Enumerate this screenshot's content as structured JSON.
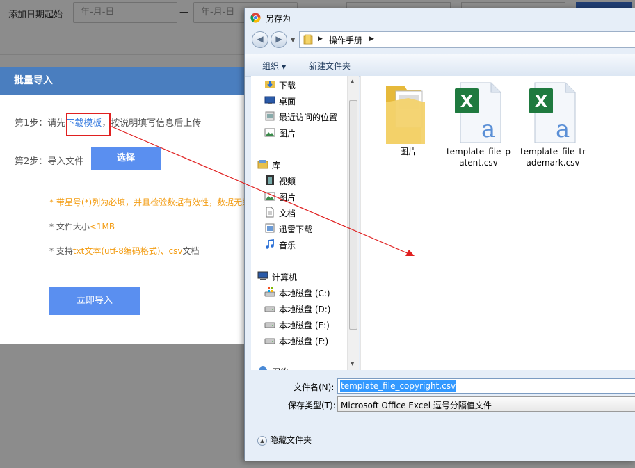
{
  "background_page": {
    "filter_label": "添加日期起始",
    "date_start_placeholder": "年-月-日",
    "date_separator": "—",
    "date_end_placeholder": "年-月-日"
  },
  "modal": {
    "title": "批量导入",
    "step1_prefix": "第1步：请先",
    "step1_link": "下载模板",
    "step1_suffix": "，按说明填写信息后上传",
    "step2_label": "第2步：导入文件",
    "select_button": "选择",
    "note1": "* 带星号(*)列为必填，并且检验数据有效性，数据无效",
    "note2_prefix": "* 文件大小",
    "note2_value": "<1MB",
    "note3_prefix": "* 支持",
    "note3_formats": "txt文本(utf-8编码格式)、csv",
    "note3_suffix": "文档",
    "import_button": "立即导入",
    "accent_color": "#4a7ebf",
    "button_color": "#5a8ff0",
    "note_color": "#f39c12"
  },
  "save_dialog": {
    "title": "另存为",
    "address_path": "操作手册",
    "toolbar": {
      "organize": "组织",
      "new_folder": "新建文件夹"
    },
    "nav_items": [
      {
        "label": "下载",
        "icon": "download-folder-icon"
      },
      {
        "label": "桌面",
        "icon": "desktop-icon"
      },
      {
        "label": "最近访问的位置",
        "icon": "recent-places-icon"
      },
      {
        "label": "图片",
        "icon": "pictures-icon"
      },
      {
        "label": "库",
        "icon": "library-icon"
      },
      {
        "label": "视频",
        "icon": "video-icon"
      },
      {
        "label": "图片",
        "icon": "pictures-icon"
      },
      {
        "label": "文档",
        "icon": "documents-icon"
      },
      {
        "label": "迅雷下载",
        "icon": "thunder-download-icon"
      },
      {
        "label": "音乐",
        "icon": "music-icon"
      },
      {
        "label": "计算机",
        "icon": "computer-icon"
      },
      {
        "label": "本地磁盘 (C:)",
        "icon": "system-drive-icon"
      },
      {
        "label": "本地磁盘 (D:)",
        "icon": "drive-icon"
      },
      {
        "label": "本地磁盘 (E:)",
        "icon": "drive-icon"
      },
      {
        "label": "本地磁盘 (F:)",
        "icon": "drive-icon"
      },
      {
        "label": "网络",
        "icon": "network-icon"
      }
    ],
    "files": [
      {
        "name": "图片",
        "type": "folder"
      },
      {
        "name": "template_file_patent.csv",
        "type": "csv"
      },
      {
        "name": "template_file_trademark.csv",
        "type": "csv"
      }
    ],
    "filename_label": "文件名(N):",
    "filename_value": "template_file_copyright.csv",
    "filetype_label": "保存类型(T):",
    "filetype_value": "Microsoft Office Excel 逗号分隔值文件",
    "hide_folders": "隐藏文件夹"
  }
}
